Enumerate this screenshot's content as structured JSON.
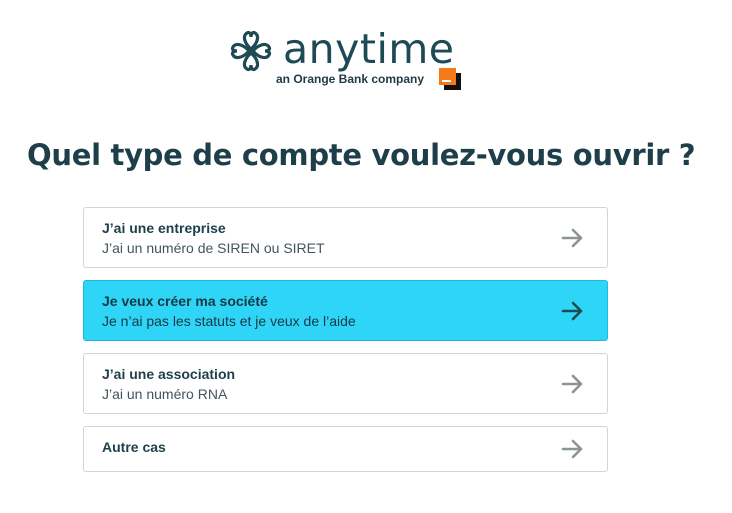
{
  "brand": {
    "name": "anytime",
    "tagline": "an Orange Bank company",
    "color": "#1e4a55",
    "partner_color": "#f27a1a"
  },
  "question": {
    "title": "Quel type de compte voulez-vous ouvrir ?"
  },
  "options": [
    {
      "title": "J’ai une entreprise",
      "subtitle": "J’ai un numéro de SIREN ou SIRET",
      "icon": "arrow-right-icon",
      "selected": false
    },
    {
      "title": "Je veux créer ma société",
      "subtitle": "Je n’ai pas les statuts et je veux de l’aide",
      "icon": "arrow-right-icon",
      "selected": true
    },
    {
      "title": "J’ai une association",
      "subtitle": "J’ai un numéro RNA",
      "icon": "arrow-right-icon",
      "selected": false
    },
    {
      "title": "Autre cas",
      "subtitle": "",
      "icon": "arrow-right-icon",
      "selected": false
    }
  ],
  "colors": {
    "selected_background": "#2fd5f7",
    "heading": "#1e3f4a",
    "border": "#cfd6da",
    "arrow": "#8a9499",
    "arrow_selected": "#1e4a55"
  }
}
